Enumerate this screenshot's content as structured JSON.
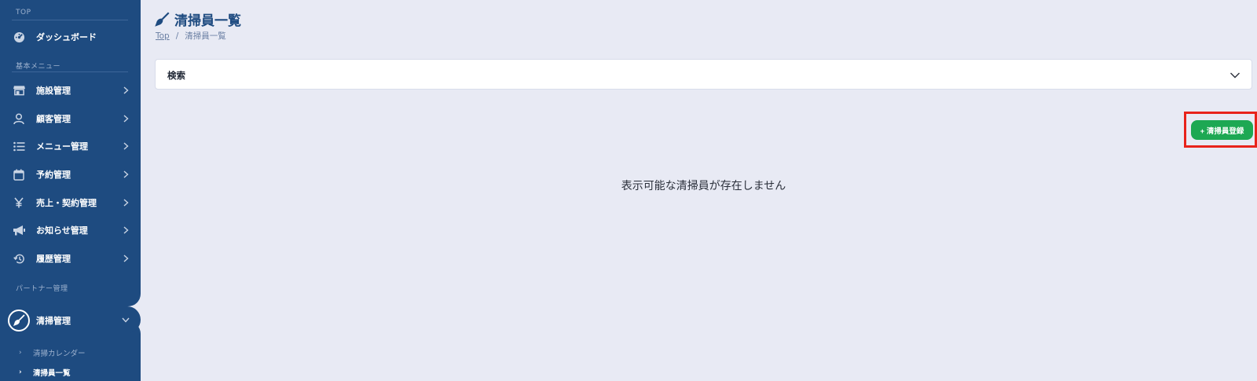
{
  "sidebar": {
    "sections": {
      "top": "TOP",
      "basic_menu": "基本メニュー",
      "partner": "パートナー管理"
    },
    "items": [
      {
        "label": "ダッシュボード",
        "icon": "dashboard-gauge-icon"
      },
      {
        "label": "施設管理",
        "icon": "store-icon"
      },
      {
        "label": "顧客管理",
        "icon": "user-icon"
      },
      {
        "label": "メニュー管理",
        "icon": "list-icon"
      },
      {
        "label": "予約管理",
        "icon": "calendar-icon"
      },
      {
        "label": "売上・契約管理",
        "icon": "yen-icon"
      },
      {
        "label": "お知らせ管理",
        "icon": "megaphone-icon"
      },
      {
        "label": "履歴管理",
        "icon": "history-icon"
      }
    ],
    "active_item": {
      "label": "清掃管理",
      "icon": "broom-icon"
    },
    "sub_items": [
      {
        "label": "清掃カレンダー"
      },
      {
        "label": "清掃員一覧"
      }
    ],
    "colors": {
      "background": "#1e4b80",
      "text": "#ffffff"
    }
  },
  "header": {
    "title": "清掃員一覧",
    "title_icon": "broom-icon",
    "breadcrumb": {
      "home": "Top",
      "separator": "/",
      "current": "清掃員一覧"
    }
  },
  "search": {
    "label": "検索",
    "icon": "chevron-down-icon"
  },
  "actions": {
    "add_button": "+ 清掃員登録",
    "add_color": "#1da853",
    "highlight_color": "#e8231b"
  },
  "main": {
    "empty_message": "表示可能な清掃員が存在しません"
  }
}
